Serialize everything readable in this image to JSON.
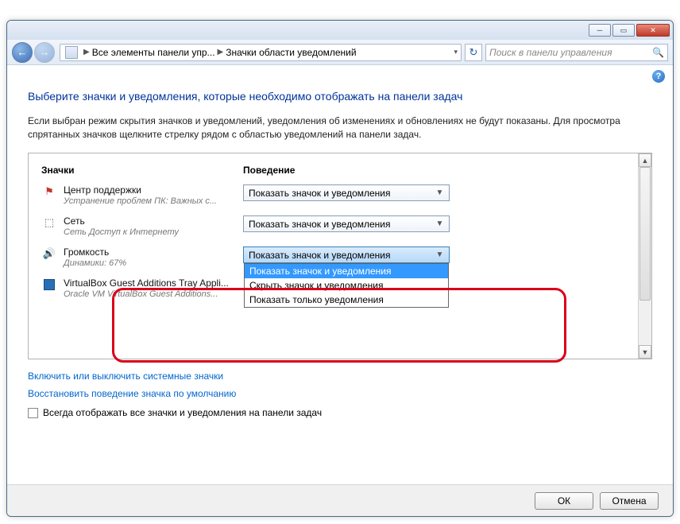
{
  "breadcrumb": {
    "root": "Все элементы панели упр...",
    "current": "Значки области уведомлений"
  },
  "search": {
    "placeholder": "Поиск в панели управления"
  },
  "heading": "Выберите значки и уведомления, которые необходимо отображать на панели задач",
  "description": "Если выбран режим скрытия значков и уведомлений, уведомления об изменениях и обновлениях не будут показаны. Для просмотра спрятанных значков щелкните стрелку рядом с областью уведомлений на панели задач.",
  "columns": {
    "icons": "Значки",
    "behavior": "Поведение"
  },
  "rows": [
    {
      "name": "Центр поддержки",
      "sub": "Устранение проблем ПК: Важных с...",
      "value": "Показать значок и уведомления"
    },
    {
      "name": "Сеть",
      "sub": "Сеть Доступ к Интернету",
      "value": "Показать значок и уведомления"
    },
    {
      "name": "Громкость",
      "sub": "Динамики: 67%",
      "value": "Показать значок и уведомления"
    },
    {
      "name": "VirtualBox Guest Additions Tray Appli...",
      "sub": "Oracle VM VirtualBox Guest Additions...",
      "value": ""
    }
  ],
  "dropdown_options": [
    "Показать значок и уведомления",
    "Скрыть значок и уведомления",
    "Показать только уведомления"
  ],
  "links": {
    "system_icons": "Включить или выключить системные значки",
    "restore": "Восстановить поведение значка по умолчанию"
  },
  "checkbox_label": "Всегда отображать все значки и уведомления на панели задач",
  "buttons": {
    "ok": "ОК",
    "cancel": "Отмена"
  }
}
